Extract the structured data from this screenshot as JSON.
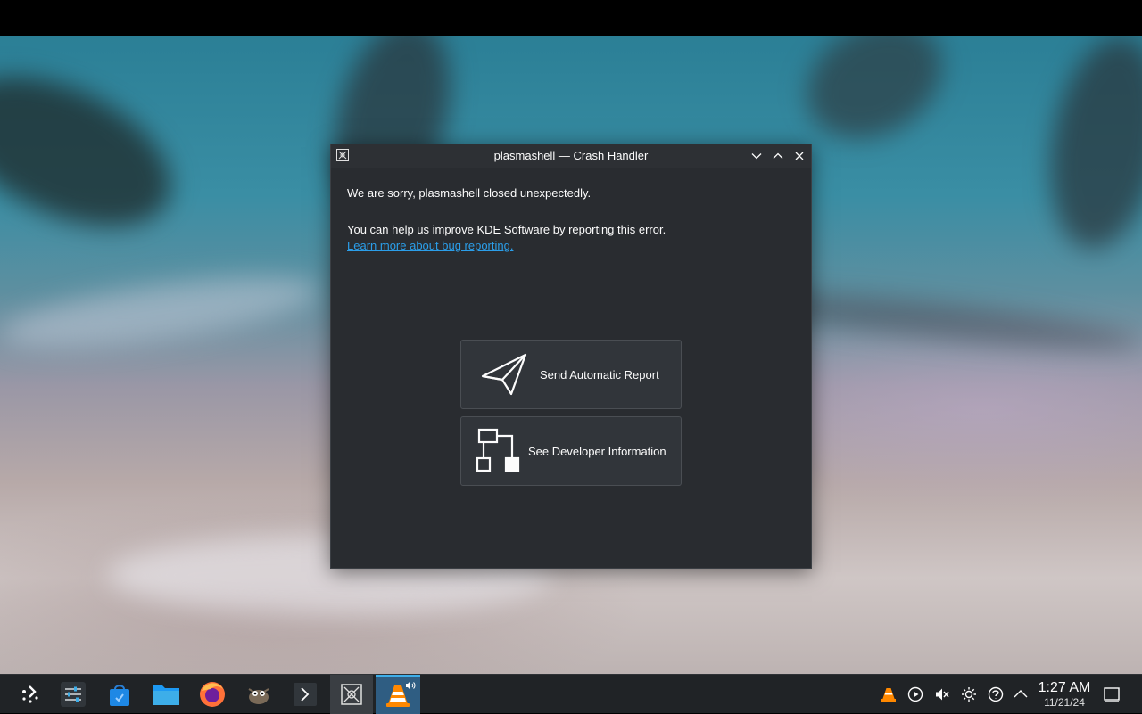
{
  "dialog": {
    "title": "plasmashell — Crash Handler",
    "message": "We are sorry, plasmashell closed unexpectedly.",
    "help_text": "You can help us improve KDE Software by reporting this error.",
    "learn_more_link": "Learn more about bug reporting.",
    "send_report_label": "Send Automatic Report",
    "developer_info_label": "See Developer Information",
    "icons": {
      "app": "crash-handler-icon",
      "minimize": "chevron-down-icon",
      "maximize": "chevron-up-icon",
      "close": "close-icon",
      "send": "paper-plane-icon",
      "developer": "flowchart-icon"
    }
  },
  "taskbar": {
    "items": [
      {
        "name": "application-launcher",
        "icon": "kde-launcher-icon"
      },
      {
        "name": "system-settings",
        "icon": "settings-sliders-icon"
      },
      {
        "name": "discover",
        "icon": "store-bag-icon"
      },
      {
        "name": "dolphin",
        "icon": "folder-icon"
      },
      {
        "name": "firefox",
        "icon": "firefox-icon"
      },
      {
        "name": "gimp",
        "icon": "gimp-icon"
      },
      {
        "name": "konsole",
        "icon": "terminal-icon"
      },
      {
        "name": "crash-handler-task",
        "icon": "crash-handler-icon",
        "active": true
      },
      {
        "name": "vlc-task",
        "icon": "vlc-cone-icon",
        "active": true,
        "playing_audio": true
      }
    ],
    "tray": {
      "icons": [
        "vlc-cone-icon",
        "media-play-icon",
        "volume-muted-icon",
        "brightness-icon",
        "network-icon",
        "chevron-up-icon"
      ],
      "time": "1:27 AM",
      "date": "11/21/24"
    }
  },
  "colors": {
    "accent": "#3daee9",
    "link": "#2b9ee9",
    "dialog_bg": "#292c30",
    "taskbar_bg": "#202326"
  }
}
